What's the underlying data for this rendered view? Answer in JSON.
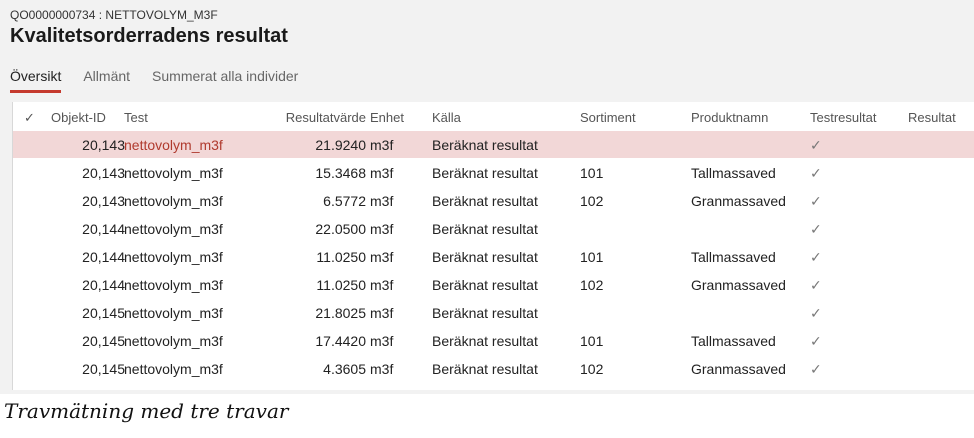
{
  "header": {
    "record_id": "QO0000000734 : NETTOVOLYM_M3F",
    "title": "Kvalitetsorderradens resultat"
  },
  "tabs": [
    {
      "label": "Översikt",
      "active": true
    },
    {
      "label": "Allmänt",
      "active": false
    },
    {
      "label": "Summerat alla individer",
      "active": false
    }
  ],
  "grid": {
    "columns": {
      "check": "✓",
      "object_id": "Objekt-ID",
      "test": "Test",
      "value": "Resultatvärde",
      "unit": "Enhet",
      "source": "Källa",
      "assortment": "Sortiment",
      "product": "Produktnamn",
      "test_result": "Testresultat",
      "result": "Resultat"
    },
    "rows": [
      {
        "object_id": "20,143",
        "test": "nettovolym_m3f",
        "value": "21.9240",
        "unit": "m3f",
        "source": "Beräknat resultat",
        "assortment": "",
        "product": "",
        "test_result": "✓",
        "result": "",
        "selected": true
      },
      {
        "object_id": "20,143",
        "test": "nettovolym_m3f",
        "value": "15.3468",
        "unit": "m3f",
        "source": "Beräknat resultat",
        "assortment": "101",
        "product": "Tallmassaved",
        "test_result": "✓",
        "result": ""
      },
      {
        "object_id": "20,143",
        "test": "nettovolym_m3f",
        "value": "6.5772",
        "unit": "m3f",
        "source": "Beräknat resultat",
        "assortment": "102",
        "product": "Granmassaved",
        "test_result": "✓",
        "result": ""
      },
      {
        "object_id": "20,144",
        "test": "nettovolym_m3f",
        "value": "22.0500",
        "unit": "m3f",
        "source": "Beräknat resultat",
        "assortment": "",
        "product": "",
        "test_result": "✓",
        "result": ""
      },
      {
        "object_id": "20,144",
        "test": "nettovolym_m3f",
        "value": "11.0250",
        "unit": "m3f",
        "source": "Beräknat resultat",
        "assortment": "101",
        "product": "Tallmassaved",
        "test_result": "✓",
        "result": ""
      },
      {
        "object_id": "20,144",
        "test": "nettovolym_m3f",
        "value": "11.0250",
        "unit": "m3f",
        "source": "Beräknat resultat",
        "assortment": "102",
        "product": "Granmassaved",
        "test_result": "✓",
        "result": ""
      },
      {
        "object_id": "20,145",
        "test": "nettovolym_m3f",
        "value": "21.8025",
        "unit": "m3f",
        "source": "Beräknat resultat",
        "assortment": "",
        "product": "",
        "test_result": "✓",
        "result": ""
      },
      {
        "object_id": "20,145",
        "test": "nettovolym_m3f",
        "value": "17.4420",
        "unit": "m3f",
        "source": "Beräknat resultat",
        "assortment": "101",
        "product": "Tallmassaved",
        "test_result": "✓",
        "result": ""
      },
      {
        "object_id": "20,145",
        "test": "nettovolym_m3f",
        "value": "4.3605",
        "unit": "m3f",
        "source": "Beräknat resultat",
        "assortment": "102",
        "product": "Granmassaved",
        "test_result": "✓",
        "result": ""
      }
    ]
  },
  "caption": "Travmätning med tre travar"
}
